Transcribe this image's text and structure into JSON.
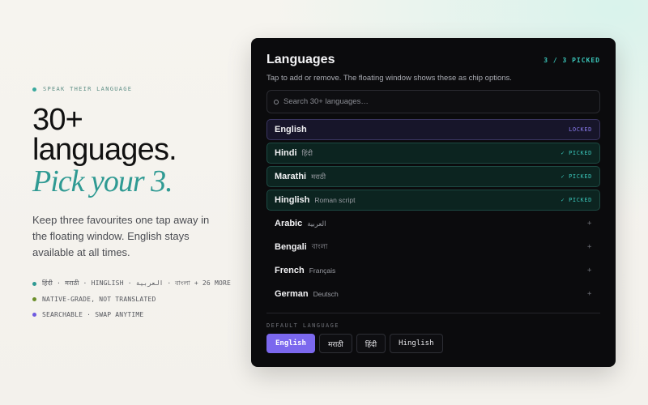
{
  "hero": {
    "eyebrow": "SPEAK THEIR LANGUAGE",
    "headline_1": "30+",
    "headline_2": "languages.",
    "headline_italic": "Pick your 3.",
    "body": "Keep three favourites one tap away in the floating window. English stays available at all times.",
    "bullets": [
      {
        "text": "हिंदी · मराठी · HINGLISH · العربية · বাংলা + 26 MORE",
        "color": "#2f9a93"
      },
      {
        "text": "NATIVE-GRADE, NOT TRANSLATED",
        "color": "#6b8f2a"
      },
      {
        "text": "SEARCHABLE · SWAP ANYTIME",
        "color": "#6f5be0"
      }
    ],
    "eyebrow_color": "#3aa99e"
  },
  "panel": {
    "title": "Languages",
    "picked_count": "3 / 3 PICKED",
    "subtitle": "Tap to add or remove. The floating window shows these as chip options.",
    "search": {
      "placeholder": "Search 30+ languages…",
      "value": ""
    },
    "languages": [
      {
        "name": "English",
        "native": "",
        "status": "LOCKED",
        "state": "locked"
      },
      {
        "name": "Hindi",
        "native": "हिंदी",
        "status": "✓ PICKED",
        "state": "picked"
      },
      {
        "name": "Marathi",
        "native": "मराठी",
        "status": "✓ PICKED",
        "state": "picked"
      },
      {
        "name": "Hinglish",
        "native": "Roman script",
        "status": "✓ PICKED",
        "state": "picked"
      },
      {
        "name": "Arabic",
        "native": "العربية",
        "status": "+",
        "state": "available"
      },
      {
        "name": "Bengali",
        "native": "বাংলা",
        "status": "+",
        "state": "available"
      },
      {
        "name": "French",
        "native": "Français",
        "status": "+",
        "state": "available"
      },
      {
        "name": "German",
        "native": "Deutsch",
        "status": "+",
        "state": "available"
      }
    ],
    "default_label": "DEFAULT LANGUAGE",
    "default_chips": [
      {
        "label": "English",
        "active": true
      },
      {
        "label": "मराठी",
        "active": false
      },
      {
        "label": "हिंदी",
        "active": false
      },
      {
        "label": "Hinglish",
        "active": false
      }
    ]
  },
  "colors": {
    "accent_purple": "#7b68ee",
    "accent_teal": "#3ac4b8",
    "panel_bg": "#0b0b0d"
  }
}
